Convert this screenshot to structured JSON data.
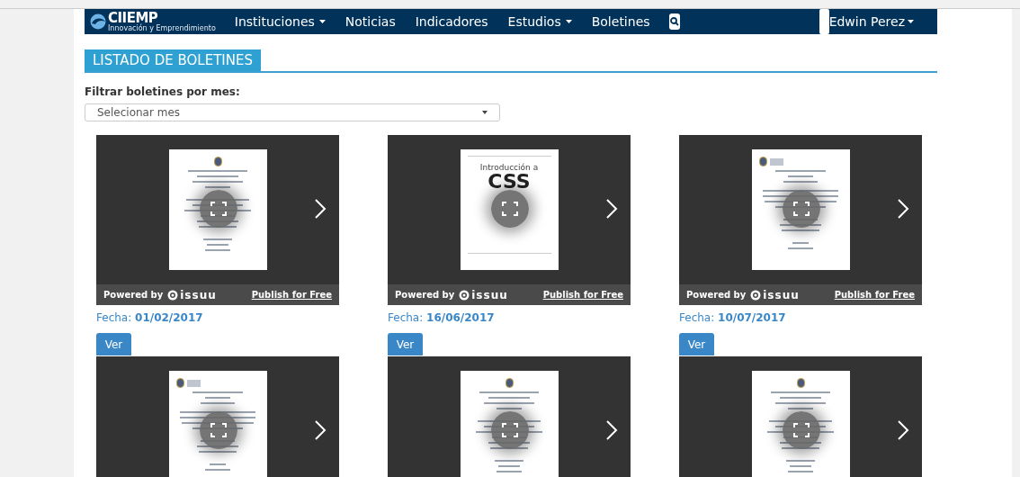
{
  "navbar": {
    "brand": "CIIEMP",
    "brand_tagline": "Innovación y Emprendimiento",
    "items": [
      {
        "label": "Instituciones",
        "dropdown": true
      },
      {
        "label": "Noticias",
        "dropdown": false
      },
      {
        "label": "Indicadores",
        "dropdown": false
      },
      {
        "label": "Estudios",
        "dropdown": true
      },
      {
        "label": "Boletines",
        "dropdown": false
      }
    ],
    "user": "Edwin Perez"
  },
  "section_title": "LISTADO DE BOLETINES",
  "filter": {
    "label": "Filtrar boletines por mes:",
    "placeholder": "Selecionar mes"
  },
  "cards": [
    {
      "kind": "seal-center",
      "powered_by": "Powered by",
      "issuu": "issuu",
      "publish": "Publish for Free",
      "date_label": "Fecha:",
      "date": "01/02/2017",
      "button": "Ver"
    },
    {
      "kind": "cover",
      "cover_title": "Introducción a",
      "cover_subtitle": "CSS",
      "powered_by": "Powered by",
      "issuu": "issuu",
      "publish": "Publish for Free",
      "date_label": "Fecha:",
      "date": "16/06/2017",
      "button": "Ver"
    },
    {
      "kind": "seal-left",
      "powered_by": "Powered by",
      "issuu": "issuu",
      "publish": "Publish for Free",
      "date_label": "Fecha:",
      "date": "10/07/2017",
      "button": "Ver"
    },
    {
      "kind": "seal-left"
    },
    {
      "kind": "seal-center"
    },
    {
      "kind": "seal-center"
    }
  ]
}
